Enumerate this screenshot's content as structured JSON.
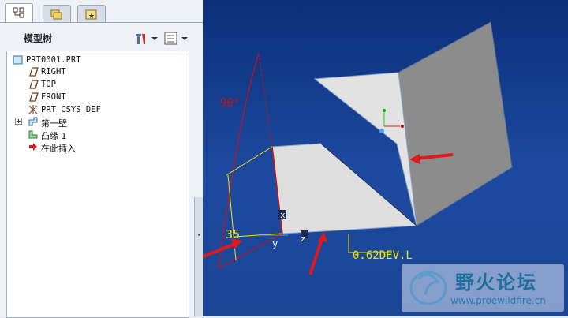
{
  "panel": {
    "title": "模型树",
    "tabs": [
      "model-tree-tab",
      "layer-tab",
      "favorites-tab"
    ],
    "tree": [
      {
        "icon": "part-icon",
        "label": "PRT0001.PRT"
      },
      {
        "icon": "datum-plane-icon",
        "label": "RIGHT"
      },
      {
        "icon": "datum-plane-icon",
        "label": "TOP"
      },
      {
        "icon": "datum-plane-icon",
        "label": "FRONT"
      },
      {
        "icon": "csys-icon",
        "label": "PRT_CSYS_DEF"
      },
      {
        "icon": "first-wall-icon",
        "label": "第一壁"
      },
      {
        "icon": "flange-icon",
        "label": "凸缘 1"
      },
      {
        "icon": "insert-here-icon",
        "label": "在此插入"
      }
    ]
  },
  "viewport": {
    "annotations": {
      "angle": "90°",
      "length": "35",
      "offset": "0.62DEV.L",
      "axis_x": "x",
      "axis_y": "y",
      "axis_z": "z"
    },
    "colors": {
      "dim_red": "#cc1111",
      "dim_yellow": "#f2e600",
      "arrow_red": "#e01a1a"
    }
  },
  "watermark": {
    "title": "野火论坛",
    "url": "www.proewildfire.cn"
  }
}
